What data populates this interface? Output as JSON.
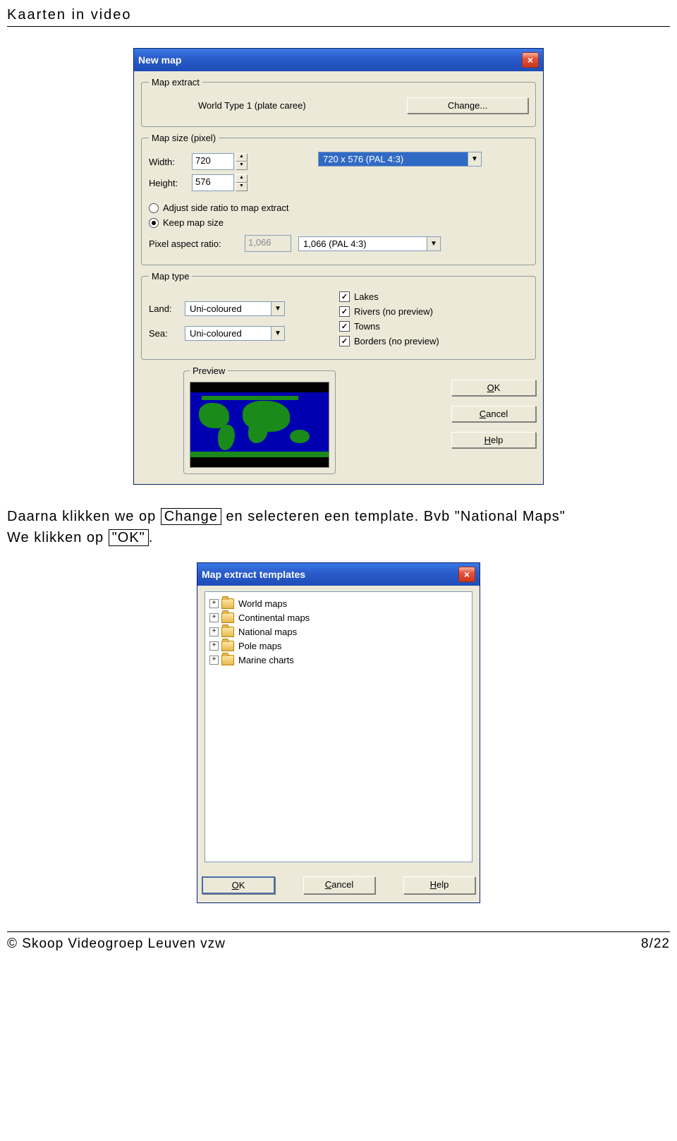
{
  "doc": {
    "header": "Kaarten in video",
    "para1a": "Daarna klikken we op ",
    "para1b": "Change",
    "para1c": " en selecteren een template. Bvb \"National Maps\"",
    "para2a": "We klikken op ",
    "para2b": "\"OK\"",
    "para2c": ".",
    "footer_left": "© Skoop Videogroep Leuven vzw",
    "footer_right": "8/22"
  },
  "dialog1": {
    "title": "New map",
    "map_extract": {
      "legend": "Map extract",
      "value": "World Type 1 (plate caree)",
      "change_btn": "Change..."
    },
    "map_size": {
      "legend": "Map size (pixel)",
      "width_lbl": "Width:",
      "width_val": "720",
      "height_lbl": "Height:",
      "height_val": "576",
      "preset": "720 x 576   (PAL 4:3)",
      "radio1": "Adjust side ratio to map extract",
      "radio2": "Keep map size",
      "par_lbl": "Pixel aspect ratio:",
      "par_val": "1,066",
      "par_combo": "1,066   (PAL 4:3)"
    },
    "map_type": {
      "legend": "Map type",
      "land_lbl": "Land:",
      "land_val": "Uni-coloured",
      "sea_lbl": "Sea:",
      "sea_val": "Uni-coloured",
      "chk1": "Lakes",
      "chk2": "Rivers (no preview)",
      "chk3": "Towns",
      "chk4": "Borders (no preview)"
    },
    "preview_legend": "Preview",
    "buttons": {
      "ok": "OK",
      "cancel": "Cancel",
      "help": "Help"
    }
  },
  "dialog2": {
    "title": "Map extract templates",
    "tree": [
      "World maps",
      "Continental maps",
      "National maps",
      "Pole maps",
      "Marine charts"
    ],
    "buttons": {
      "ok": "OK",
      "cancel": "Cancel",
      "help": "Help"
    }
  }
}
